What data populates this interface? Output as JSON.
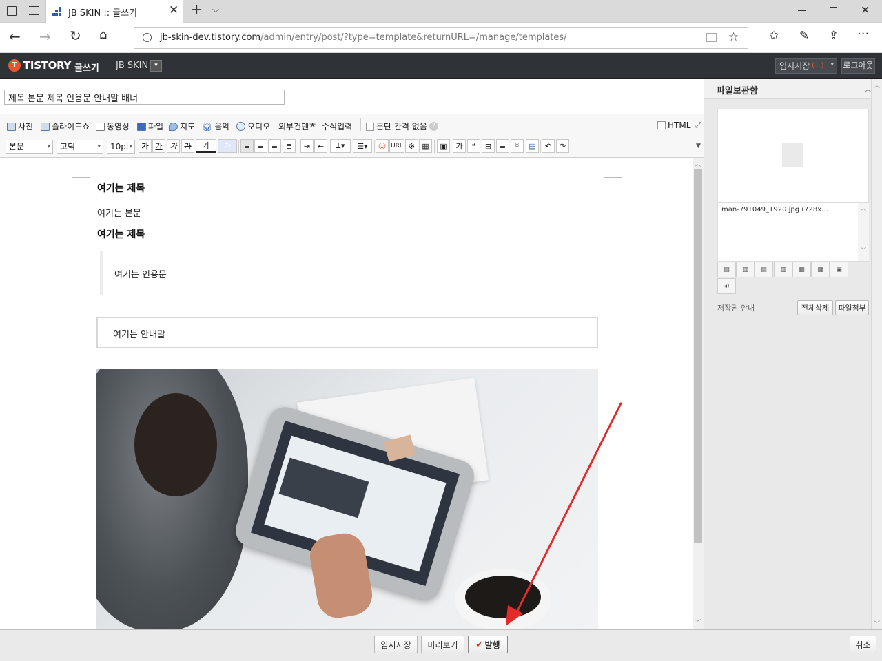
{
  "browser": {
    "tab_title": "JB SKIN :: 글쓰기",
    "url_host": "jb-skin-dev.tistory.com",
    "url_path": "/admin/entry/post/?type=template&returnURL=/manage/templates/"
  },
  "app": {
    "logo": "TISTORY",
    "section": "글쓰기",
    "blog_name": "JB SKIN",
    "temp_save_label": "임시저장",
    "temp_save_status": "(...)",
    "logout_label": "로그아웃"
  },
  "post": {
    "title": "제목 본문 제목 인용문 안내말 배너"
  },
  "toolbar1": {
    "items": [
      "사진",
      "슬라이드쇼",
      "동영상",
      "파일",
      "지도",
      "음악",
      "오디오",
      "외부컨텐츠",
      "수식입력"
    ],
    "paragraph_spacing": "문단 간격 없음",
    "html": "HTML"
  },
  "toolbar2": {
    "format": "본문",
    "font": "고딕",
    "size": "10pt",
    "bold": "가",
    "underline": "가",
    "italic": "가",
    "strike": "가",
    "color": "가",
    "bg": "가",
    "url": "URL",
    "special": "※",
    "box": "가",
    "quote": "❝",
    "more": "ʬ"
  },
  "content": {
    "heading1": "여기는 제목",
    "body": "여기는 본문",
    "heading2": "여기는 제목",
    "quote": "여기는 인용문",
    "notice": "여기는 안내말"
  },
  "sidebar": {
    "title": "파일보관함",
    "file_name": "man-791049_1920.jpg (728x…",
    "copyright": "저작권 안내",
    "delete_all": "전체삭제",
    "attach": "파일첨부"
  },
  "bottom": {
    "temp_save": "임시저장",
    "preview": "미리보기",
    "publish": "발행",
    "cancel": "취소"
  },
  "colors": {
    "app_bar": "#2f3338",
    "accent": "#e8552a",
    "annotation_arrow": "#e52a2a"
  }
}
